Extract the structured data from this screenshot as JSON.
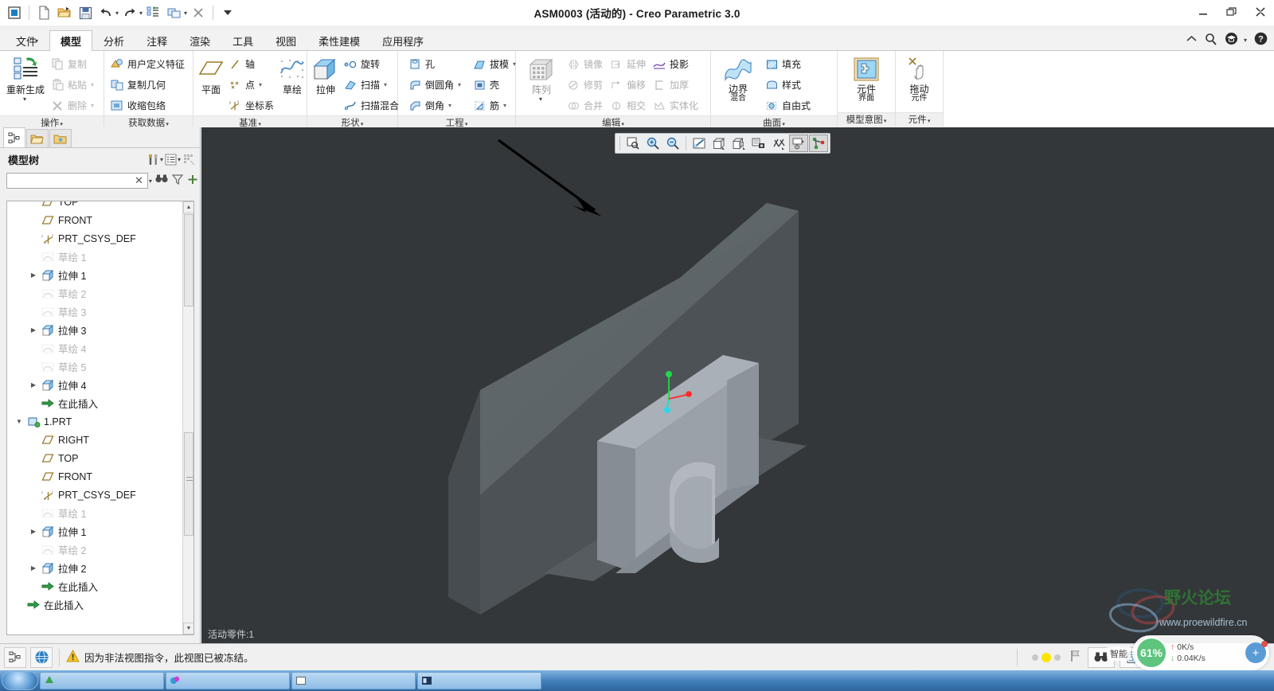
{
  "window": {
    "title": "ASM0003 (活动的) - Creo Parametric 3.0",
    "minimize": "—",
    "restore": "❐",
    "close": "✕"
  },
  "quick_access": [
    {
      "name": "app-menu-icon",
      "glyph": "▣"
    },
    {
      "name": "new-icon",
      "glyph": "🗋"
    },
    {
      "name": "open-icon",
      "glyph": "📂"
    },
    {
      "name": "save-icon",
      "glyph": "💾"
    },
    {
      "name": "undo-icon",
      "glyph": "↶"
    },
    {
      "name": "redo-icon",
      "glyph": "↷"
    },
    {
      "name": "regenerate-icon",
      "glyph": "⇄"
    },
    {
      "name": "window-icon",
      "glyph": "❐"
    },
    {
      "name": "close-window-icon",
      "glyph": "✖"
    },
    {
      "name": "customize-qat-icon",
      "glyph": "▾"
    }
  ],
  "title_right_icons": [
    {
      "name": "collapse-ribbon-icon",
      "glyph": "⌃"
    },
    {
      "name": "search-icon",
      "glyph": "🔍"
    },
    {
      "name": "learning-connector-icon",
      "glyph": "🎓"
    },
    {
      "name": "help-icon",
      "glyph": "?"
    }
  ],
  "tabs": [
    {
      "label": "文件",
      "has_caret": true,
      "active": false
    },
    {
      "label": "模型",
      "has_caret": false,
      "active": true
    },
    {
      "label": "分析",
      "has_caret": false,
      "active": false
    },
    {
      "label": "注释",
      "has_caret": false,
      "active": false
    },
    {
      "label": "渲染",
      "has_caret": false,
      "active": false
    },
    {
      "label": "工具",
      "has_caret": false,
      "active": false
    },
    {
      "label": "视图",
      "has_caret": false,
      "active": false
    },
    {
      "label": "柔性建模",
      "has_caret": false,
      "active": false
    },
    {
      "label": "应用程序",
      "has_caret": false,
      "active": false
    }
  ],
  "ribbon": {
    "groups": [
      {
        "label": "操作",
        "big": [
          {
            "label_top": "重新生成",
            "label_bottom": "",
            "icon": "regenerate-icon",
            "has_caret": true,
            "disabled": false
          }
        ],
        "smalls": [
          {
            "label": "复制",
            "icon": "copy-icon",
            "caret": false,
            "disabled": true
          },
          {
            "label": "粘贴",
            "icon": "paste-icon",
            "caret": true,
            "disabled": true
          },
          {
            "label": "删除",
            "icon": "delete-icon",
            "caret": true,
            "disabled": true
          }
        ]
      },
      {
        "label": "获取数据",
        "big": [],
        "smalls": [
          {
            "label": "用户定义特征",
            "icon": "udf-icon",
            "caret": false,
            "disabled": false
          },
          {
            "label": "复制几何",
            "icon": "copy-geometry-icon",
            "caret": false,
            "disabled": false
          },
          {
            "label": "收缩包络",
            "icon": "shrinkwrap-icon",
            "caret": false,
            "disabled": false
          }
        ]
      },
      {
        "label": "基准",
        "big": [
          {
            "label_top": "平面",
            "label_bottom": "",
            "icon": "datum-plane-icon",
            "has_caret": false,
            "disabled": false
          },
          {
            "label_top": "草绘",
            "label_bottom": "",
            "icon": "sketch-icon",
            "has_caret": false,
            "disabled": false
          }
        ],
        "smalls": [
          {
            "label": "轴",
            "icon": "datum-axis-icon",
            "caret": false,
            "disabled": false
          },
          {
            "label": "点",
            "icon": "datum-point-icon",
            "caret": true,
            "disabled": false
          },
          {
            "label": "坐标系",
            "icon": "coordinate-system-icon",
            "caret": false,
            "disabled": false
          }
        ]
      },
      {
        "label": "形状",
        "big": [
          {
            "label_top": "拉伸",
            "label_bottom": "",
            "icon": "extrude-icon",
            "has_caret": false,
            "disabled": false
          }
        ],
        "smalls": [
          {
            "label": "旋转",
            "icon": "revolve-icon",
            "caret": false,
            "disabled": false
          },
          {
            "label": "扫描",
            "icon": "sweep-icon",
            "caret": true,
            "disabled": false
          },
          {
            "label": "扫描混合",
            "icon": "swept-blend-icon",
            "caret": false,
            "disabled": false
          }
        ]
      },
      {
        "label": "工程",
        "big": [],
        "smalls_a": [
          {
            "label": "孔",
            "icon": "hole-icon",
            "caret": false,
            "disabled": false
          },
          {
            "label": "倒圆角",
            "icon": "round-icon",
            "caret": true,
            "disabled": false
          },
          {
            "label": "倒角",
            "icon": "chamfer-icon",
            "caret": true,
            "disabled": false
          }
        ],
        "smalls_b": [
          {
            "label": "拔模",
            "icon": "draft-icon",
            "caret": true,
            "disabled": false
          },
          {
            "label": "壳",
            "icon": "shell-icon",
            "caret": false,
            "disabled": false
          },
          {
            "label": "筋",
            "icon": "rib-icon",
            "caret": true,
            "disabled": false
          }
        ]
      },
      {
        "label": "编辑",
        "big": [
          {
            "label_top": "阵列",
            "label_bottom": "",
            "icon": "pattern-icon",
            "has_caret": true,
            "disabled": true
          }
        ],
        "smalls_a": [
          {
            "label": "镜像",
            "icon": "mirror-icon",
            "caret": false,
            "disabled": true
          },
          {
            "label": "修剪",
            "icon": "trim-icon",
            "caret": false,
            "disabled": true
          },
          {
            "label": "合并",
            "icon": "merge-icon",
            "caret": false,
            "disabled": true
          }
        ],
        "smalls_b": [
          {
            "label": "延伸",
            "icon": "extend-icon",
            "caret": false,
            "disabled": true
          },
          {
            "label": "偏移",
            "icon": "offset-icon",
            "caret": false,
            "disabled": true
          },
          {
            "label": "相交",
            "icon": "intersect-icon",
            "caret": false,
            "disabled": true
          }
        ],
        "smalls_c": [
          {
            "label": "投影",
            "icon": "project-icon",
            "caret": false,
            "disabled": false
          },
          {
            "label": "加厚",
            "icon": "thicken-icon",
            "caret": false,
            "disabled": true
          },
          {
            "label": "实体化",
            "icon": "solidify-icon",
            "caret": false,
            "disabled": true
          }
        ]
      },
      {
        "label": "曲面",
        "big": [
          {
            "label_top": "边界",
            "label_bottom": "混合",
            "icon": "boundary-blend-icon",
            "has_caret": false,
            "disabled": false
          }
        ],
        "smalls": [
          {
            "label": "填充",
            "icon": "fill-icon",
            "caret": false,
            "disabled": false
          },
          {
            "label": "样式",
            "icon": "style-icon",
            "caret": false,
            "disabled": false
          },
          {
            "label": "自由式",
            "icon": "freestyle-icon",
            "caret": false,
            "disabled": false
          }
        ]
      },
      {
        "label": "模型意图",
        "big": [
          {
            "label_top": "元件",
            "label_bottom": "界面",
            "icon": "component-interface-icon",
            "has_caret": false,
            "disabled": false
          }
        ],
        "smalls": []
      },
      {
        "label": "元件",
        "big": [
          {
            "label_top": "拖动",
            "label_bottom": "元件",
            "icon": "drag-component-icon",
            "has_caret": false,
            "disabled": false
          }
        ],
        "smalls": []
      }
    ]
  },
  "left_panel": {
    "tabs": [
      {
        "name": "model-tree-tab",
        "icon": "model-tree-icon",
        "active": true
      },
      {
        "name": "folder-browser-tab",
        "icon": "folder-icon",
        "active": false
      },
      {
        "name": "favorites-tab",
        "icon": "favorites-folder-icon",
        "active": false
      }
    ],
    "title": "模型树",
    "header_buttons": [
      {
        "name": "settings-icon",
        "glyph": "⚒",
        "caret": true
      },
      {
        "name": "display-icon",
        "glyph": "▤",
        "caret": true
      },
      {
        "name": "tree-filter-icon",
        "glyph": "▦",
        "caret": false
      }
    ],
    "search": {
      "value": "",
      "placeholder": "",
      "clear": "✕",
      "dropdown": "▾",
      "find_icon": "find-icon",
      "filter_icon": "filter-icon",
      "add_icon": "+"
    },
    "tree": [
      {
        "label": "TOP",
        "icon": "datum-plane-icon",
        "indent": 1,
        "arrow": "none",
        "dim": false,
        "clipped": true
      },
      {
        "label": "FRONT",
        "icon": "datum-plane-icon",
        "indent": 1,
        "arrow": "none",
        "dim": false
      },
      {
        "label": "PRT_CSYS_DEF",
        "icon": "csys-icon",
        "indent": 1,
        "arrow": "none",
        "dim": false
      },
      {
        "label": "草绘 1",
        "icon": "sketch-icon",
        "indent": 1,
        "arrow": "none",
        "dim": true
      },
      {
        "label": "拉伸 1",
        "icon": "extrude-feature-icon",
        "indent": 1,
        "arrow": "collapsed",
        "dim": false
      },
      {
        "label": "草绘 2",
        "icon": "sketch-icon",
        "indent": 1,
        "arrow": "none",
        "dim": true
      },
      {
        "label": "草绘 3",
        "icon": "sketch-icon",
        "indent": 1,
        "arrow": "none",
        "dim": true
      },
      {
        "label": "拉伸 3",
        "icon": "extrude-feature-icon",
        "indent": 1,
        "arrow": "collapsed",
        "dim": false
      },
      {
        "label": "草绘 4",
        "icon": "sketch-icon",
        "indent": 1,
        "arrow": "none",
        "dim": true
      },
      {
        "label": "草绘 5",
        "icon": "sketch-icon",
        "indent": 1,
        "arrow": "none",
        "dim": true
      },
      {
        "label": "拉伸 4",
        "icon": "extrude-feature-icon",
        "indent": 1,
        "arrow": "collapsed",
        "dim": false
      },
      {
        "label": "在此插入",
        "icon": "insert-here-icon",
        "indent": 1,
        "arrow": "none",
        "dim": false
      },
      {
        "label": "1.PRT",
        "icon": "part-icon",
        "indent": 0,
        "arrow": "expanded",
        "dim": false
      },
      {
        "label": "RIGHT",
        "icon": "datum-plane-icon",
        "indent": 1,
        "arrow": "none",
        "dim": false
      },
      {
        "label": "TOP",
        "icon": "datum-plane-icon",
        "indent": 1,
        "arrow": "none",
        "dim": false
      },
      {
        "label": "FRONT",
        "icon": "datum-plane-icon",
        "indent": 1,
        "arrow": "none",
        "dim": false
      },
      {
        "label": "PRT_CSYS_DEF",
        "icon": "csys-icon",
        "indent": 1,
        "arrow": "none",
        "dim": false
      },
      {
        "label": "草绘 1",
        "icon": "sketch-icon",
        "indent": 1,
        "arrow": "none",
        "dim": true
      },
      {
        "label": "拉伸 1",
        "icon": "extrude-feature-icon",
        "indent": 1,
        "arrow": "collapsed",
        "dim": false
      },
      {
        "label": "草绘 2",
        "icon": "sketch-icon",
        "indent": 1,
        "arrow": "none",
        "dim": true
      },
      {
        "label": "拉伸 2",
        "icon": "extrude-feature-icon",
        "indent": 1,
        "arrow": "collapsed",
        "dim": false
      },
      {
        "label": "在此插入",
        "icon": "insert-here-icon",
        "indent": 1,
        "arrow": "none",
        "dim": false
      },
      {
        "label": "在此插入",
        "icon": "insert-here-icon",
        "indent": 0,
        "arrow": "none",
        "dim": false
      }
    ]
  },
  "viewport": {
    "background_color": "#33373a",
    "active_part_label": "活动零件:1",
    "graphics_toolbar": [
      {
        "name": "refit-icon",
        "glyph": "refit"
      },
      {
        "name": "zoom-in-icon",
        "glyph": "zoomin"
      },
      {
        "name": "zoom-out-icon",
        "glyph": "zoomout"
      },
      {
        "name": "repaint-icon",
        "glyph": "repaint"
      },
      {
        "name": "display-style-icon",
        "glyph": "shaded"
      },
      {
        "name": "saved-orientations-icon",
        "glyph": "orient"
      },
      {
        "name": "scene-icon",
        "glyph": "scene"
      },
      {
        "name": "datum-display-icon",
        "glyph": "datum"
      },
      {
        "name": "annotation-display-icon",
        "glyph": "annot"
      },
      {
        "name": "spin-center-icon",
        "glyph": "spin"
      }
    ],
    "model": {
      "plate_color": "#4d5256",
      "plate_top_color": "#596065",
      "block_color": "#9ba1a8",
      "block_top_color": "#b3b8bf",
      "annotation_arrow": "black-arrow",
      "triad_colors": {
        "x": "#ff2a2a",
        "y": "#22d84a",
        "z": "#28d9e8"
      }
    },
    "watermark": {
      "line1": "野火论坛",
      "line2": "www.proewildfire.cn"
    }
  },
  "status_bar": {
    "left_buttons": [
      {
        "name": "selection-filter-icon",
        "glyph": "⬚"
      },
      {
        "name": "web-browser-icon",
        "glyph": "🌐"
      }
    ],
    "warning_icon": "warning-icon",
    "message": "因为非法视图指令，此视图已被冻结。",
    "indicator_flag": "flag-icon",
    "right_buttons": [
      {
        "name": "search-binoculars-icon",
        "glyph": "find"
      },
      {
        "name": "appearance-gallery-icon",
        "glyph": "cube"
      }
    ]
  },
  "speed_widget": {
    "percent": "61%",
    "upload": "0K/s",
    "download": "0.04K/s",
    "up_arrow": "↑",
    "down_arrow": "↓",
    "plus": "+",
    "smart_label": "智能"
  },
  "taskbar": {
    "items": [
      {
        "name": "taskbar-item-1",
        "label": ""
      },
      {
        "name": "taskbar-item-2",
        "label": ""
      },
      {
        "name": "taskbar-item-3",
        "label": ""
      },
      {
        "name": "taskbar-item-4",
        "label": ""
      }
    ]
  }
}
